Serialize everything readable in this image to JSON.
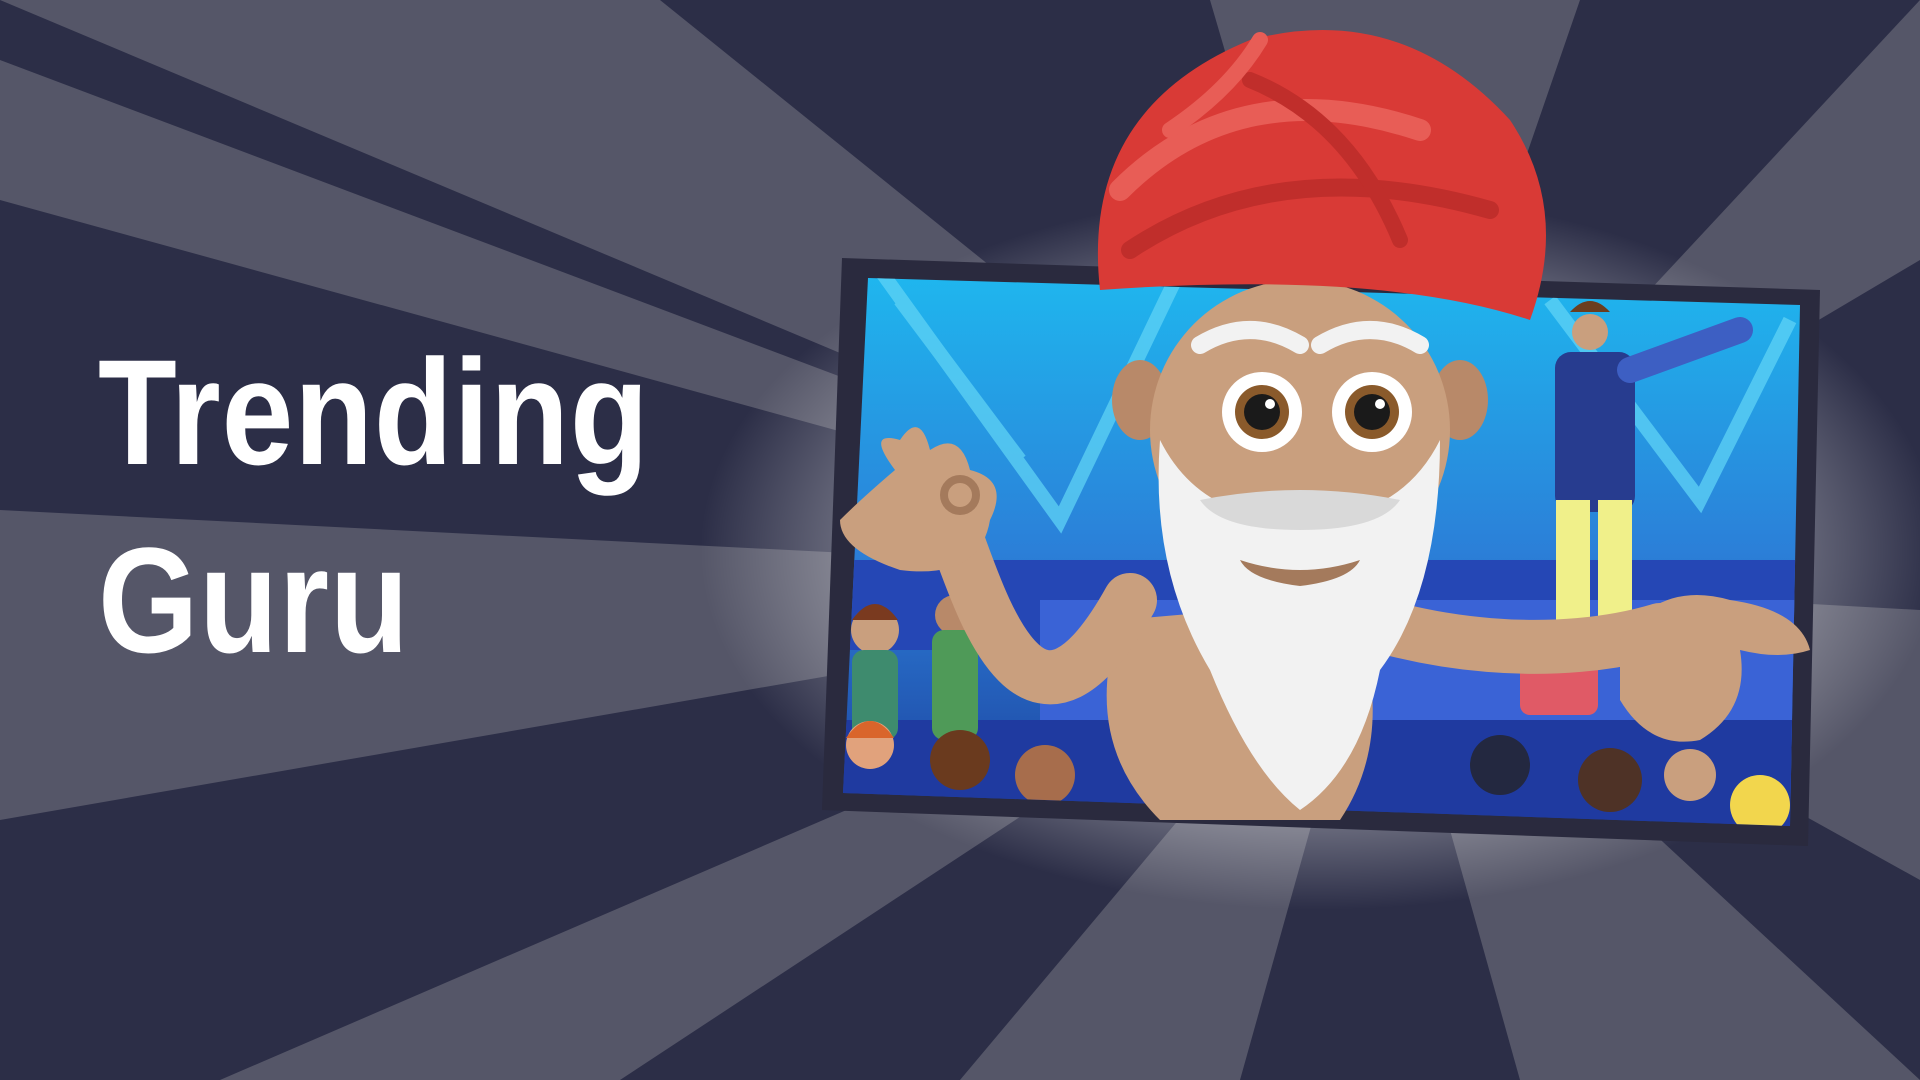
{
  "thumbnail": {
    "title_line1": "Trending",
    "title_line2": "Guru"
  },
  "colors": {
    "background_dark": "#2c2e47",
    "background_ray": "#555668",
    "title_text": "#ffffff",
    "turban_red": "#d93a36",
    "skin_tan": "#c99f7e",
    "beard_white": "#f2f2f2",
    "screen_blue": "#2f86e0",
    "frame_dark": "#2a2a3e"
  },
  "icons": {
    "character": "guru-character",
    "scene": "concert-stage-scene"
  }
}
